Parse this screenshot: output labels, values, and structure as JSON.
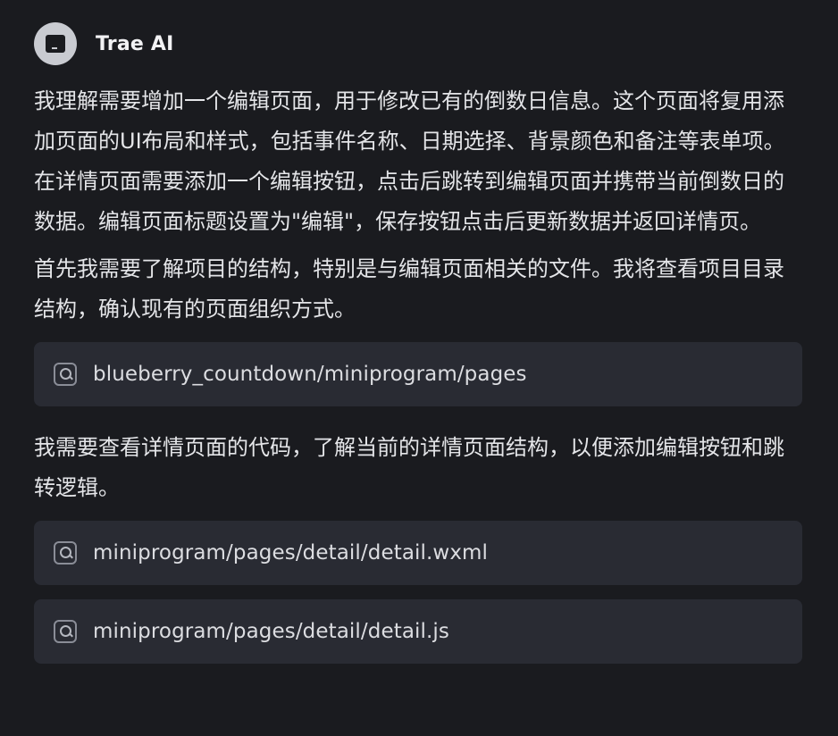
{
  "assistant": {
    "name": "Trae AI"
  },
  "messages": [
    "我理解需要增加一个编辑页面，用于修改已有的倒数日信息。这个页面将复用添加页面的UI布局和样式，包括事件名称、日期选择、背景颜色和备注等表单项。在详情页面需要添加一个编辑按钮，点击后跳转到编辑页面并携带当前倒数日的数据。编辑页面标题设置为\"编辑\"，保存按钮点击后更新数据并返回详情页。",
    "首先我需要了解项目的结构，特别是与编辑页面相关的文件。我将查看项目目录结构，确认现有的页面组织方式。",
    "我需要查看详情页面的代码，了解当前的详情页面结构，以便添加编辑按钮和跳转逻辑。"
  ],
  "searches": [
    "blueberry_countdown/miniprogram/pages",
    "miniprogram/pages/detail/detail.wxml",
    "miniprogram/pages/detail/detail.js"
  ],
  "icons": {
    "avatar": "terminal-icon",
    "search": "search-icon"
  },
  "colors": {
    "background": "#1a1b1f",
    "card": "#292b33",
    "text": "#e4e5e8",
    "avatar": "#c9cbd1"
  }
}
